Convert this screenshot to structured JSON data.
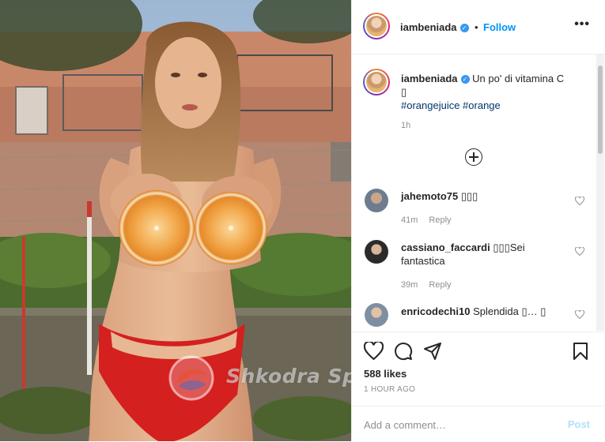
{
  "post": {
    "username": "iambeniada",
    "follow_label": "Follow",
    "separator": "•",
    "more_label": "•••",
    "caption": "Un po' di vitamina C",
    "caption_emoji": "▯",
    "hashtags": "#orangejuice #orange",
    "caption_time": "1h",
    "likes": "588 likes",
    "time_ago": "1 HOUR AGO",
    "add_comment_placeholder": "Add a comment…",
    "post_label": "Post"
  },
  "comments": [
    {
      "username": "jahemoto75",
      "text": "▯▯▯",
      "time": "41m",
      "reply": "Reply"
    },
    {
      "username": "cassiano_faccardi",
      "text": "▯▯▯Sei fantastica",
      "time": "39m",
      "reply": "Reply"
    },
    {
      "username": "enricodechi10",
      "text": "Splendida ▯… ▯",
      "time": "",
      "reply": ""
    }
  ],
  "watermark": {
    "text": "Shkodra Sport"
  },
  "colors": {
    "link_blue": "#0095f6",
    "verified_blue": "#3897f0",
    "hashtag": "#00376b",
    "muted": "#8e8e8e",
    "post_disabled": "#b2dffc"
  },
  "icons": [
    "verified-icon",
    "more-icon",
    "plus-circle-icon",
    "heart-icon",
    "comment-icon",
    "share-icon",
    "bookmark-icon"
  ]
}
